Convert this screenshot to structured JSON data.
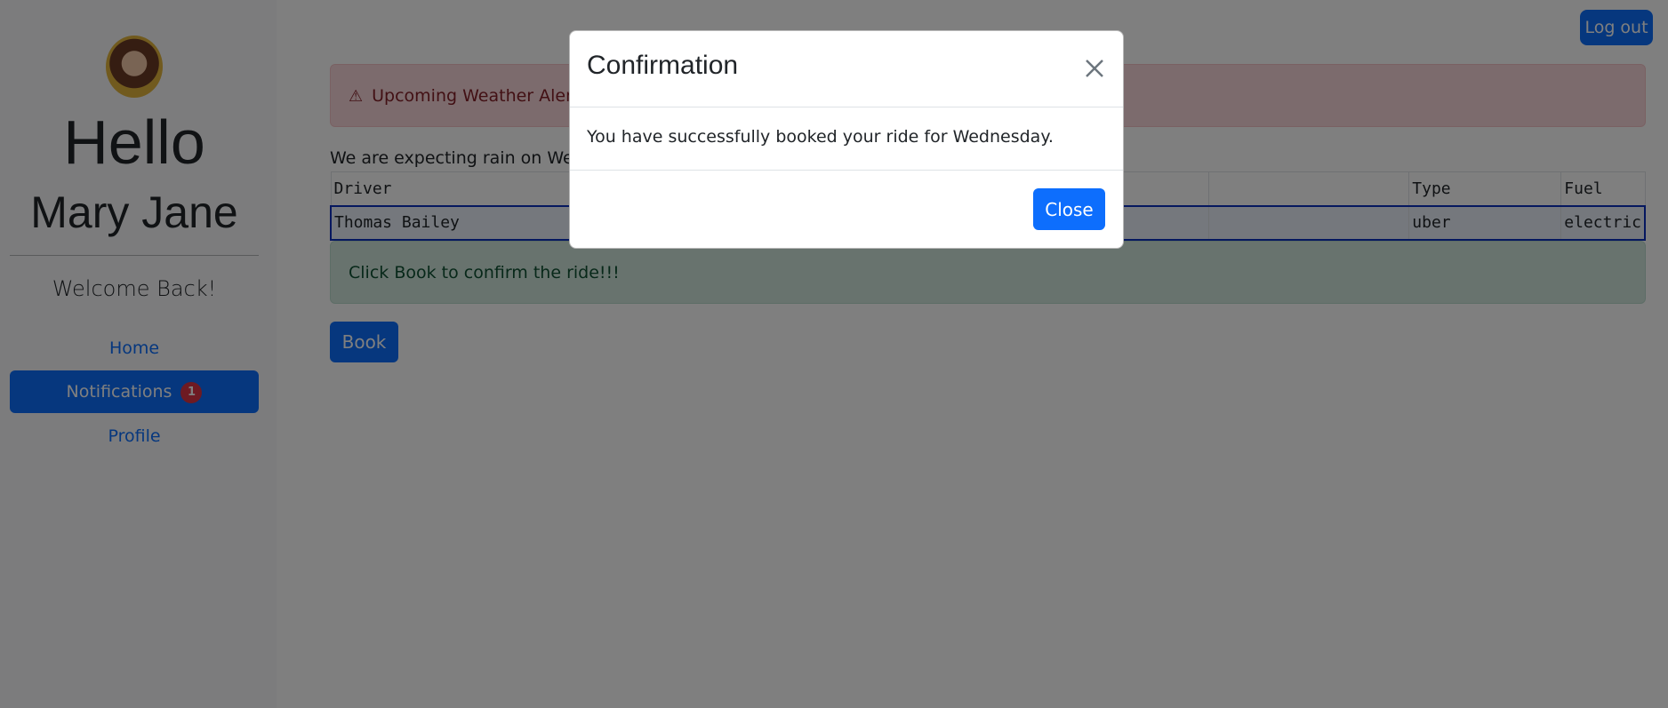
{
  "sidebar": {
    "greeting": "Hello",
    "user_name": "Mary Jane",
    "welcome": "Welcome Back!",
    "nav": {
      "home": "Home",
      "notifications": "Notifications",
      "notifications_badge": "1",
      "profile": "Profile"
    }
  },
  "header": {
    "logout_label": "Log out"
  },
  "alert": {
    "weather_title": "Upcoming Weather Alert"
  },
  "main": {
    "rain_text": "We are expecting rain on Wednesday",
    "table": {
      "headers": [
        "Driver",
        "",
        "Type",
        "Fuel"
      ],
      "rows": [
        [
          "Thomas Bailey",
          "",
          "uber",
          "electric"
        ]
      ]
    },
    "info_text": "Click Book to confirm the ride!!!",
    "book_label": "Book"
  },
  "modal": {
    "title": "Confirmation",
    "message": "You have successfully booked your ride for Wednesday.",
    "close_label": "Close"
  },
  "colors": {
    "primary": "#0d6efd",
    "danger_badge": "#dc3545",
    "alert_danger_bg": "#f8d7da",
    "alert_success_bg": "#d1e7dd",
    "sidebar_bg": "#f8f9fa"
  },
  "icons": {
    "avatar": "user-avatar",
    "alert": "warning-triangle-icon",
    "close": "close-icon"
  }
}
